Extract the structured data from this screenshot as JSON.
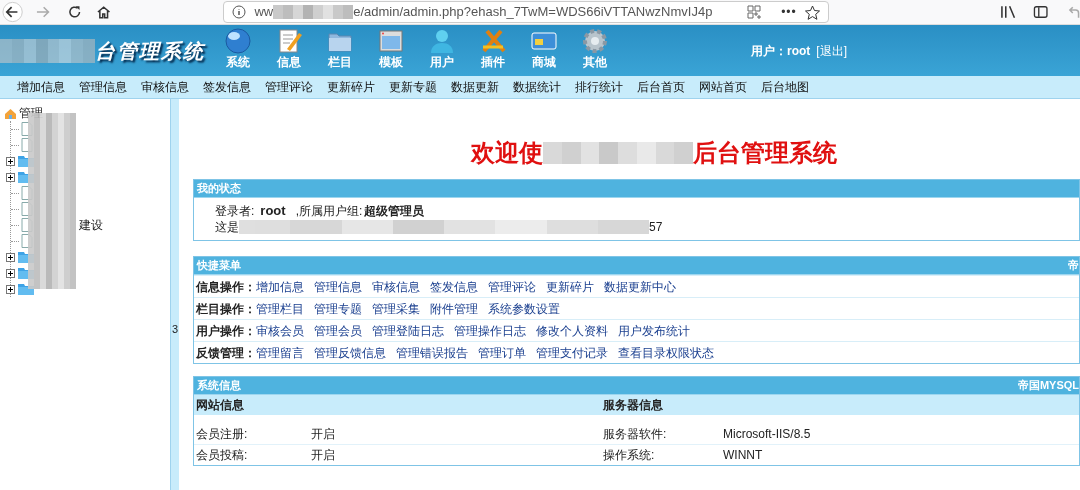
{
  "browser": {
    "more": "•••",
    "url_start": "ww",
    "url_end": "e/admin/admin.php?ehash_7TwM=WDS66iVTTANwzNmvIJ4p"
  },
  "header": {
    "logo_text": "台管理系统",
    "modules": [
      {
        "kind": "globe",
        "label": "系统"
      },
      {
        "kind": "note",
        "label": "信息"
      },
      {
        "kind": "folder",
        "label": "栏目"
      },
      {
        "kind": "window",
        "label": "模板"
      },
      {
        "kind": "person",
        "label": "用户"
      },
      {
        "kind": "tools",
        "label": "插件"
      },
      {
        "kind": "card",
        "label": "商城"
      },
      {
        "kind": "gear",
        "label": "其他"
      }
    ],
    "user": "用户：root",
    "logout": "[退出]"
  },
  "nav": [
    "增加信息",
    "管理信息",
    "审核信息",
    "签发信息",
    "管理评论",
    "更新碎片",
    "更新专题",
    "数据更新",
    "数据统计",
    "排行统计",
    "后台首页",
    "网站首页",
    "后台地图"
  ],
  "sidebar": {
    "tree": {
      "label": "管理",
      "children": [
        {
          "kind": "doc"
        },
        {
          "kind": "doc"
        },
        {
          "kind": "folder",
          "expanded": false
        },
        {
          "kind": "folder",
          "expanded": false
        },
        {
          "kind": "doc"
        },
        {
          "kind": "doc"
        },
        {
          "kind": "doc",
          "label": "建设"
        },
        {
          "kind": "doc"
        },
        {
          "kind": "folder",
          "expanded": false
        },
        {
          "kind": "folder",
          "expanded": false
        },
        {
          "kind": "folder",
          "expanded": false
        }
      ]
    },
    "splitter_mark": "3"
  },
  "welcome": {
    "start": "欢迎使",
    "end": "后台管理系统"
  },
  "status_panel": {
    "title": "我的状态",
    "login_label": "登录者:",
    "login_user": "root",
    "group_label": ",所属用户组:",
    "group": "超级管理员",
    "line2_start": "这是",
    "line2_end": "57"
  },
  "quick_menu": {
    "title": "快捷菜单",
    "title_right": "帝",
    "rows": [
      {
        "label": "信息操作：",
        "links": [
          "增加信息",
          "管理信息",
          "审核信息",
          "签发信息",
          "管理评论",
          "更新碎片",
          "数据更新中心"
        ]
      },
      {
        "label": "栏目操作：",
        "links": [
          "管理栏目",
          "管理专题",
          "管理采集",
          "附件管理",
          "系统参数设置"
        ]
      },
      {
        "label": "用户操作：",
        "links": [
          "审核会员",
          "管理会员",
          "管理登陆日志",
          "管理操作日志",
          "修改个人资料",
          "用户发布统计"
        ]
      },
      {
        "label": "反馈管理：",
        "links": [
          "管理留言",
          "管理反馈信息",
          "管理错误报告",
          "管理订单",
          "管理支付记录",
          "查看目录权限状态"
        ]
      }
    ]
  },
  "system_info": {
    "title": "系统信息",
    "title_right": "帝国MYSQL",
    "site_heading": "网站信息",
    "server_heading": "服务器信息",
    "rows": [
      {
        "site_label": "会员注册:",
        "site_value": "开启",
        "server_label": "服务器软件:",
        "server_value": "Microsoft-IIS/8.5"
      },
      {
        "site_label": "会员投稿:",
        "site_value": "开启",
        "server_label": "操作系统:",
        "server_value": "WINNT"
      }
    ]
  }
}
